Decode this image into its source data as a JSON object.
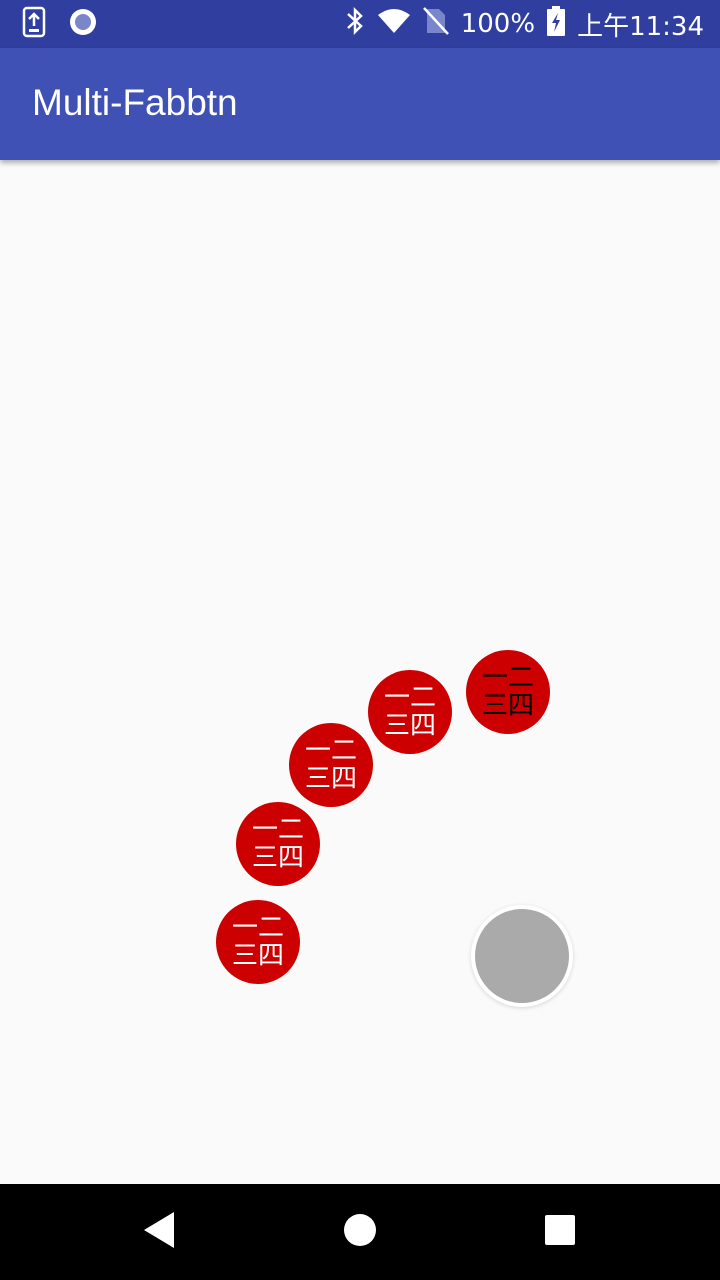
{
  "status_bar": {
    "battery_percent": "100%",
    "time": "上午11:34",
    "icons": [
      "download-notification-icon",
      "circle-notification-icon",
      "bluetooth-icon",
      "wifi-icon",
      "no-sim-icon",
      "battery-charging-icon"
    ]
  },
  "app_bar": {
    "title": "Multi-Fabbtn"
  },
  "fab_menu": {
    "items": [
      {
        "line1": "一二",
        "line2": "三四",
        "text_color": "#000000"
      },
      {
        "line1": "一二",
        "line2": "三四",
        "text_color": "#ffffff"
      },
      {
        "line1": "一二",
        "line2": "三四",
        "text_color": "#ffffff"
      },
      {
        "line1": "一二",
        "line2": "三四",
        "text_color": "#ffffff"
      },
      {
        "line1": "一二",
        "line2": "三四",
        "text_color": "#ffffff"
      }
    ],
    "item_color": "#cc0000",
    "main_button_color": "#aaaaaa"
  },
  "nav_bar": {
    "icons": [
      "back-icon",
      "home-icon",
      "recents-icon"
    ]
  }
}
